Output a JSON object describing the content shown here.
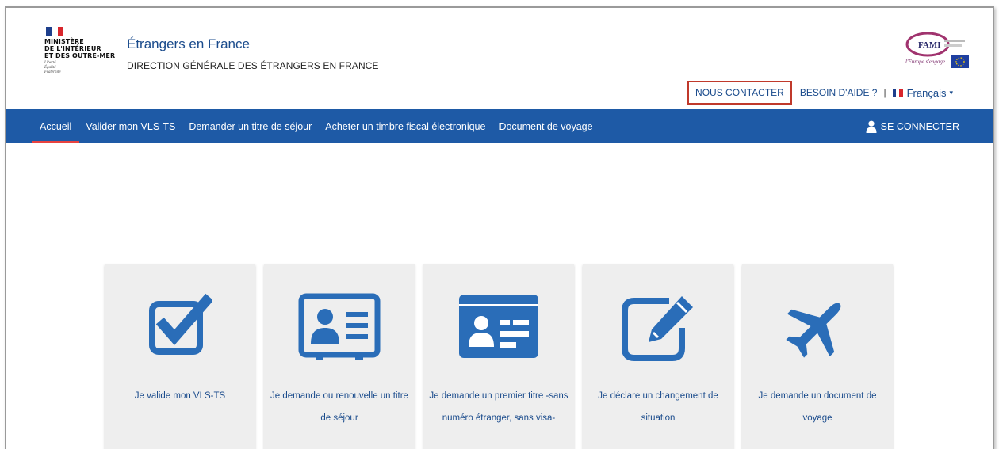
{
  "brand": {
    "ministry_lines": [
      "MINISTÈRE",
      "DE L'INTÉRIEUR",
      "ET DES OUTRE-MER"
    ],
    "motto_lines": [
      "Liberté",
      "Égalité",
      "Fraternité"
    ],
    "site_title": "Étrangers en France",
    "site_subtitle": "DIRECTION GÉNÉRALE DES ÉTRANGERS EN FRANCE",
    "partner_logo": "fami-eu-logo",
    "colors": {
      "primary": "#1e5aa6",
      "accent_red": "#e8423f",
      "link": "#1a4b8c",
      "card_bg": "#eeeeee",
      "icon": "#2a6db8"
    }
  },
  "top_links": {
    "contact": "NOUS CONTACTER",
    "help": "BESOIN D'AIDE ?",
    "separator": "|",
    "language": "Français"
  },
  "nav": {
    "items": [
      {
        "label": "Accueil",
        "active": true
      },
      {
        "label": "Valider mon VLS-TS"
      },
      {
        "label": "Demander un titre de séjour"
      },
      {
        "label": "Acheter un timbre fiscal électronique"
      },
      {
        "label": "Document de voyage"
      }
    ],
    "login_label": "SE CONNECTER",
    "login_icon": "user-icon"
  },
  "cards": [
    {
      "icon": "checkbox-check-icon",
      "lines": [
        "Je valide mon VLS-TS"
      ]
    },
    {
      "icon": "id-card-outline-icon",
      "lines": [
        "Je demande ou renouvelle un titre",
        "de séjour"
      ]
    },
    {
      "icon": "id-card-filled-icon",
      "lines": [
        "Je demande un premier titre -sans",
        "numéro étranger, sans visa-"
      ]
    },
    {
      "icon": "edit-pencil-icon",
      "lines": [
        "Je déclare un changement de",
        "situation"
      ]
    },
    {
      "icon": "airplane-icon",
      "lines": [
        "Je demande un document de",
        "voyage"
      ]
    }
  ]
}
